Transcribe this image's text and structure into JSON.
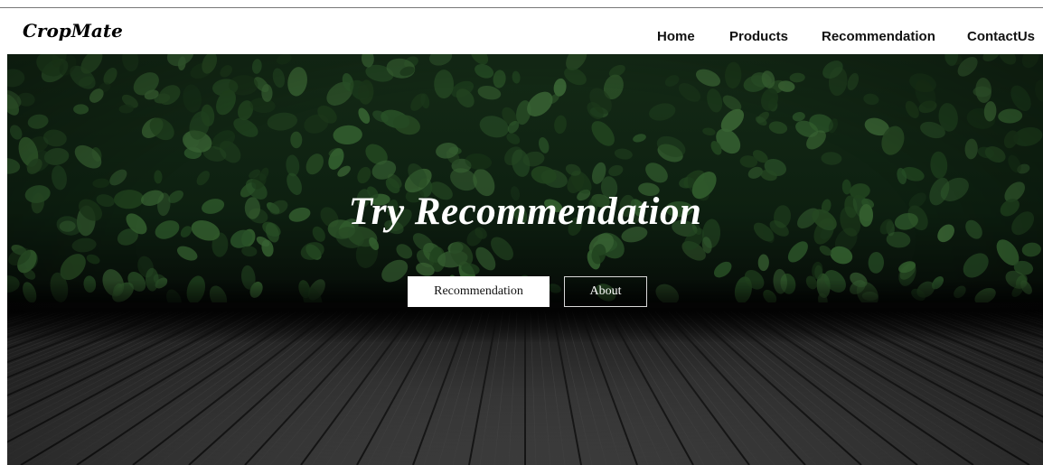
{
  "brand": {
    "logo_text": "CropMate"
  },
  "nav": {
    "items": [
      {
        "label": "Home"
      },
      {
        "label": "Products"
      },
      {
        "label": "Recommendation"
      },
      {
        "label": "ContactUs"
      }
    ]
  },
  "hero": {
    "title": "Try Recommendation",
    "primary_button": "Recommendation",
    "secondary_button": "About"
  },
  "colors": {
    "foliage_dark": "#0b1a0e",
    "leaf": "#2f5a2c",
    "deck": "#3a3a3a",
    "nav_text": "#111111",
    "button_bg": "#ffffff"
  }
}
